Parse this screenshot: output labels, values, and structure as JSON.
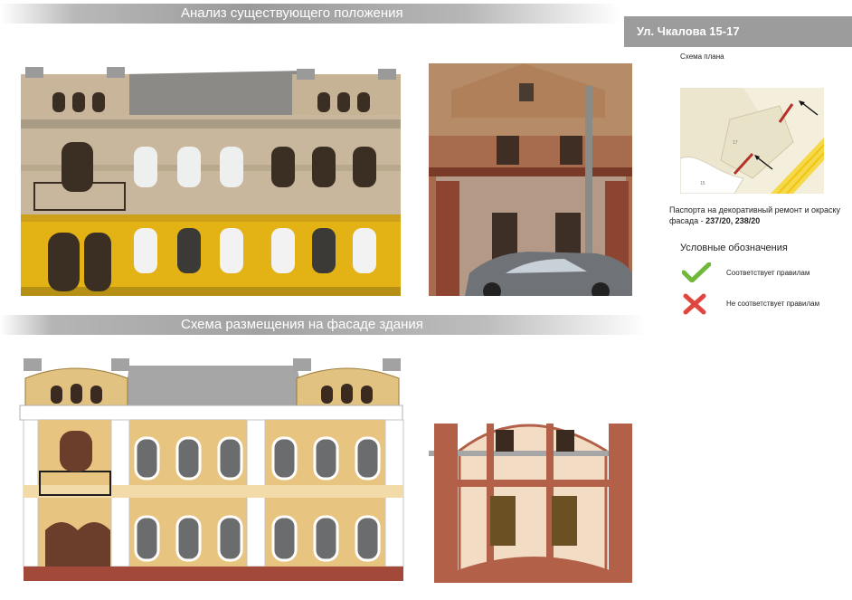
{
  "header": {
    "analysis_title": "Анализ существующего положения",
    "address": "Ул. Чкалова 15-17"
  },
  "plan": {
    "caption": "Схема плана"
  },
  "passport": {
    "text": "Паспорта на декоративный ремонт и окраску фасада - ",
    "numbers": "237/20, 238/20"
  },
  "legend": {
    "title": "Условные обозначения",
    "items": [
      {
        "icon": "checkmark-icon",
        "label": "Соответствует правилам",
        "color": "#6fb83a"
      },
      {
        "icon": "cross-icon",
        "label": "Не соответствует правилам",
        "color": "#e0463f"
      }
    ]
  },
  "scheme": {
    "title": "Схема размещения на фасаде здания"
  }
}
